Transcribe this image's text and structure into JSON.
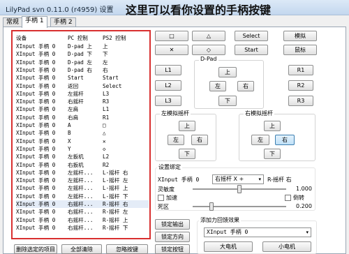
{
  "window": {
    "title": "LilyPad svn 0.11.0 (r4959) 设置"
  },
  "annotation": "这里可以看你设置的手柄按键",
  "tabs": [
    {
      "label": "常规"
    },
    {
      "label": "手柄 1"
    },
    {
      "label": "手柄 2"
    }
  ],
  "binding_list": {
    "headers": {
      "device": "设备",
      "pc": "PC 控制",
      "ps2": "PS2 控制"
    },
    "rows": [
      {
        "device": "XInput 手柄 0",
        "pc": "D-pad 上",
        "ps2": "上"
      },
      {
        "device": "XInput 手柄 0",
        "pc": "D-pad 下",
        "ps2": "下"
      },
      {
        "device": "XInput 手柄 0",
        "pc": "D-pad 左",
        "ps2": "左"
      },
      {
        "device": "XInput 手柄 0",
        "pc": "D-pad 右",
        "ps2": "右"
      },
      {
        "device": "XInput 手柄 0",
        "pc": "Start",
        "ps2": "Start"
      },
      {
        "device": "XInput 手柄 0",
        "pc": "返回",
        "ps2": "Select"
      },
      {
        "device": "XInput 手柄 0",
        "pc": "左摇杆",
        "ps2": "L3"
      },
      {
        "device": "XInput 手柄 0",
        "pc": "右摇杆",
        "ps2": "R3"
      },
      {
        "device": "XInput 手柄 0",
        "pc": "左肩",
        "ps2": "L1"
      },
      {
        "device": "XInput 手柄 0",
        "pc": "右肩",
        "ps2": "R1"
      },
      {
        "device": "XInput 手柄 0",
        "pc": "A",
        "ps2": "□"
      },
      {
        "device": "XInput 手柄 0",
        "pc": "B",
        "ps2": "△"
      },
      {
        "device": "XInput 手柄 0",
        "pc": "X",
        "ps2": "✕"
      },
      {
        "device": "XInput 手柄 0",
        "pc": "Y",
        "ps2": "◇"
      },
      {
        "device": "XInput 手柄 0",
        "pc": "左扳机",
        "ps2": "L2"
      },
      {
        "device": "XInput 手柄 0",
        "pc": "右扳机",
        "ps2": "R2"
      },
      {
        "device": "XInput 手柄 0",
        "pc": "左摇杆...",
        "ps2": "L-摇杆 右"
      },
      {
        "device": "XInput 手柄 0",
        "pc": "左摇杆...",
        "ps2": "L-摇杆 左"
      },
      {
        "device": "XInput 手柄 0",
        "pc": "左摇杆...",
        "ps2": "L-摇杆 上"
      },
      {
        "device": "XInput 手柄 0",
        "pc": "左摇杆...",
        "ps2": "L-摇杆 下"
      },
      {
        "device": "XInput 手柄 0",
        "pc": "右摇杆...",
        "ps2": "R-摇杆 右"
      },
      {
        "device": "XInput 手柄 0",
        "pc": "右摇杆...",
        "ps2": "R-摇杆 左"
      },
      {
        "device": "XInput 手柄 0",
        "pc": "右摇杆...",
        "ps2": "R-摇杆 上"
      },
      {
        "device": "XInput 手柄 0",
        "pc": "右摇杆...",
        "ps2": "R-摇杆 下"
      }
    ],
    "selected_row": 20
  },
  "face_buttons": {
    "square": "□",
    "triangle": "△",
    "select": "Select",
    "analog": "模拟",
    "cross": "✕",
    "circle": "◇",
    "start": "Start",
    "mouse": "鼠标"
  },
  "shoulder_buttons": {
    "l1": "L1",
    "l2": "L2",
    "l3": "L3",
    "r1": "R1",
    "r2": "R2",
    "r3": "R3"
  },
  "dpad": {
    "label": "D-Pad",
    "up": "上",
    "left": "左",
    "right": "右",
    "down": "下"
  },
  "left_stick": {
    "label": "左模拟摇杆",
    "up": "上",
    "left": "左",
    "right": "右",
    "down": "下"
  },
  "right_stick": {
    "label": "右模拟摇杆",
    "up": "上",
    "left": "左",
    "right": "右",
    "down": "下",
    "selected": "right"
  },
  "binding_settings": {
    "label": "设置绑定",
    "device": "XInput 手柄 0",
    "control_value": "右摇杆 X +",
    "target": "R-摇杆 右",
    "sensitivity_label": "灵敏度",
    "sensitivity_value": "1.000",
    "sensitivity_fraction": 0.5,
    "accelerate_label": "加速",
    "invert_label": "倒转",
    "deadzone_label": "死区",
    "deadzone_value": "0.200",
    "deadzone_fraction": 0.2
  },
  "action_buttons": {
    "lock_input": "锁定输出",
    "lock_direction": "锁定方向",
    "lock_buttons": "锁定按钮"
  },
  "force_feedback": {
    "label": "添加力回馈效果",
    "device": "XInput 手柄 0",
    "big_motor": "大电机",
    "small_motor": "小电机"
  },
  "bottom_buttons": {
    "delete_selected": "删除选定的项目",
    "clear_all": "全部清除",
    "ignore_key": "忽略按键"
  }
}
